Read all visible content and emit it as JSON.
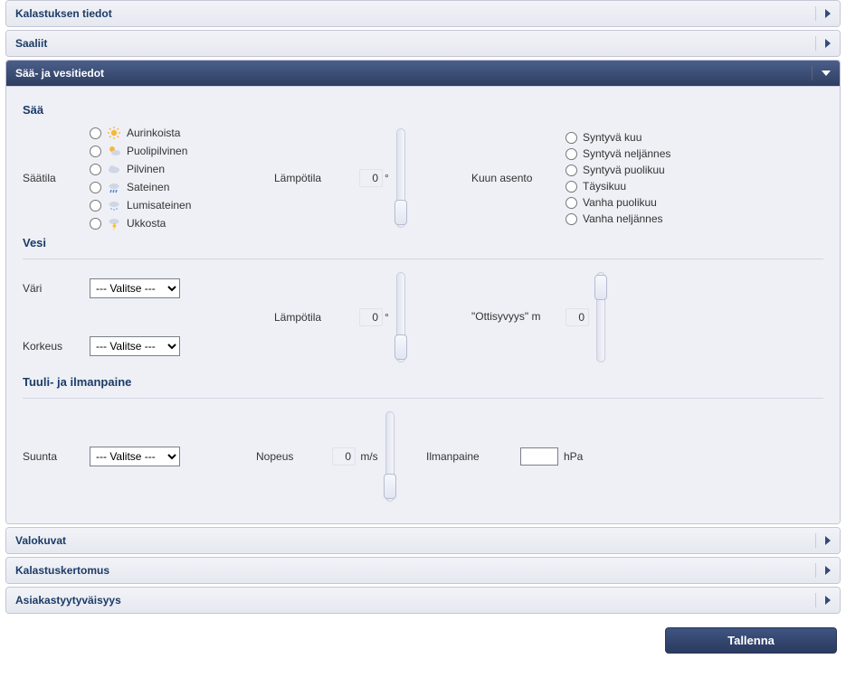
{
  "panels": {
    "p1": "Kalastuksen tiedot",
    "p2": "Saaliit",
    "p3": "Sää- ja vesitiedot",
    "p4": "Valokuvat",
    "p5": "Kalastuskertomus",
    "p6": "Asiakastyytyväisyys"
  },
  "weather": {
    "title": "Sää",
    "condition_label": "Säätila",
    "conditions": {
      "c0": "Aurinkoista",
      "c1": "Puolipilvinen",
      "c2": "Pilvinen",
      "c3": "Sateinen",
      "c4": "Lumisateinen",
      "c5": "Ukkosta"
    },
    "temp_label": "Lämpötila",
    "temp_value": "0",
    "temp_unit": "°",
    "moon_label": "Kuun asento",
    "moons": {
      "m0": "Syntyvä kuu",
      "m1": "Syntyvä neljännes",
      "m2": "Syntyvä puolikuu",
      "m3": "Täysikuu",
      "m4": "Vanha puolikuu",
      "m5": "Vanha neljännes"
    }
  },
  "water": {
    "title": "Vesi",
    "color_label": "Väri",
    "height_label": "Korkeus",
    "select_placeholder": "--- Valitse ---",
    "temp_label": "Lämpötila",
    "temp_value": "0",
    "temp_unit": "°",
    "depth_label": "\"Ottisyvyys\" m",
    "depth_value": "0"
  },
  "wind": {
    "title": "Tuuli- ja ilmanpaine",
    "dir_label": "Suunta",
    "select_placeholder": "--- Valitse ---",
    "speed_label": "Nopeus",
    "speed_value": "0",
    "speed_unit": "m/s",
    "pressure_label": "Ilmanpaine",
    "pressure_value": "",
    "pressure_unit": "hPa"
  },
  "buttons": {
    "save": "Tallenna"
  }
}
